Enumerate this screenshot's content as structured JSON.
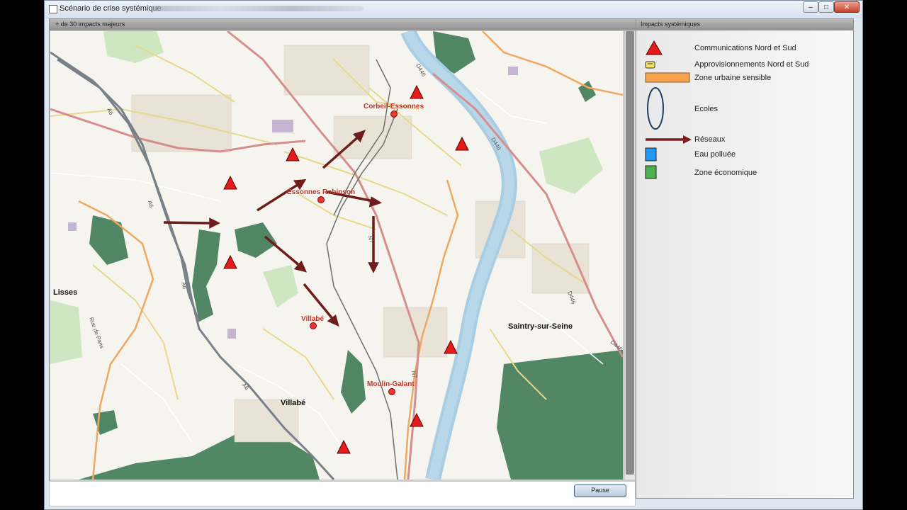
{
  "window": {
    "title": "Scénario de crise systémique",
    "min_label": "–",
    "max_label": "□",
    "close_label": "✕"
  },
  "map": {
    "header": "+ de 30 impacts majeurs",
    "labels": {
      "corbeil": "Corbeil-Essonnes",
      "essonnes": "Essonnes Robinson",
      "villabe_station": "Villabé",
      "moulin": "Moulin-Galant",
      "lisses": "Lisses",
      "villabe_town": "Villabé",
      "saintry": "Saintry-sur-Seine",
      "road_d446_1": "D446",
      "road_d446_2": "D446",
      "road_d446_3": "D446",
      "road_d446_4": "D446",
      "road_a6_1": "A6",
      "road_a6_2": "A6",
      "road_a6_3": "A6",
      "road_a6_4": "A6",
      "road_n7_1": "N7",
      "road_n7_2": "N7",
      "rue_paris": "Rue de Paris"
    }
  },
  "pause_label": "Pause",
  "legend": {
    "header": "Impacts systémiques",
    "items": [
      {
        "label": "Communications Nord et Sud",
        "icon": "red-triangle-icon",
        "color": "#e31b1b"
      },
      {
        "label": "Approvisionnements Nord et Sud",
        "icon": "yellow-supply-icon",
        "color": "#f5e663"
      },
      {
        "label": "Zone urbaine sensible",
        "icon": "orange-bar-icon",
        "color": "#f6a14c"
      },
      {
        "label": "Ecoles",
        "icon": "ellipse-icon",
        "color": "#1e3e5e"
      },
      {
        "label": "Réseaux",
        "icon": "arrow-icon",
        "color": "#7a1e1e"
      },
      {
        "label": "Eau polluée",
        "icon": "blue-square-icon",
        "color": "#2196f3"
      },
      {
        "label": "Zone économique",
        "icon": "green-square-icon",
        "color": "#4caf50"
      }
    ]
  }
}
